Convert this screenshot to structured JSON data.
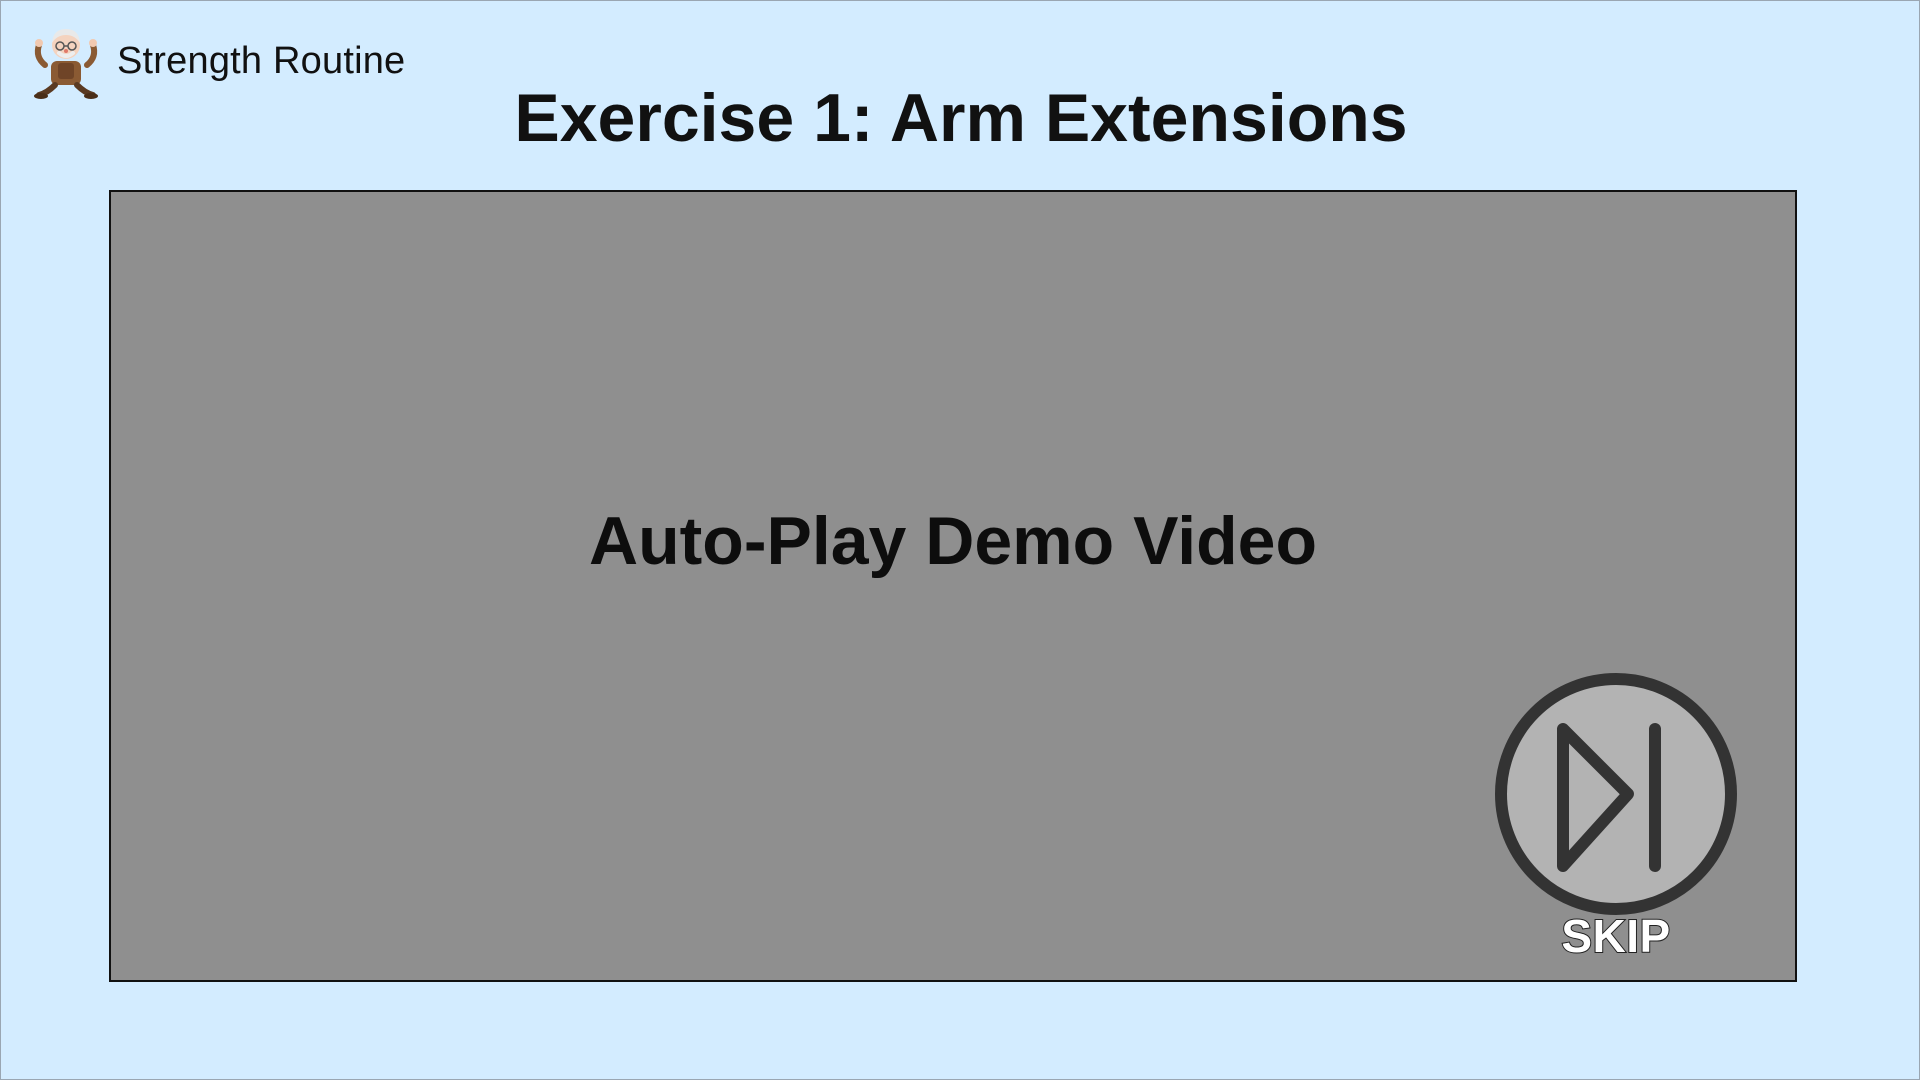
{
  "header": {
    "app_name": "Strength Routine",
    "avatar_icon": "elderly-exerciser-icon"
  },
  "exercise": {
    "title": "Exercise 1: Arm Extensions"
  },
  "video": {
    "caption": "Auto-Play Demo Video",
    "background": "#8f8f8f"
  },
  "skip": {
    "label": "SKIP",
    "icon": "skip-forward-icon"
  },
  "colors": {
    "page_background": "#d3ecff",
    "skip_fill": "#b3b3b3",
    "skip_stroke": "#333333"
  }
}
